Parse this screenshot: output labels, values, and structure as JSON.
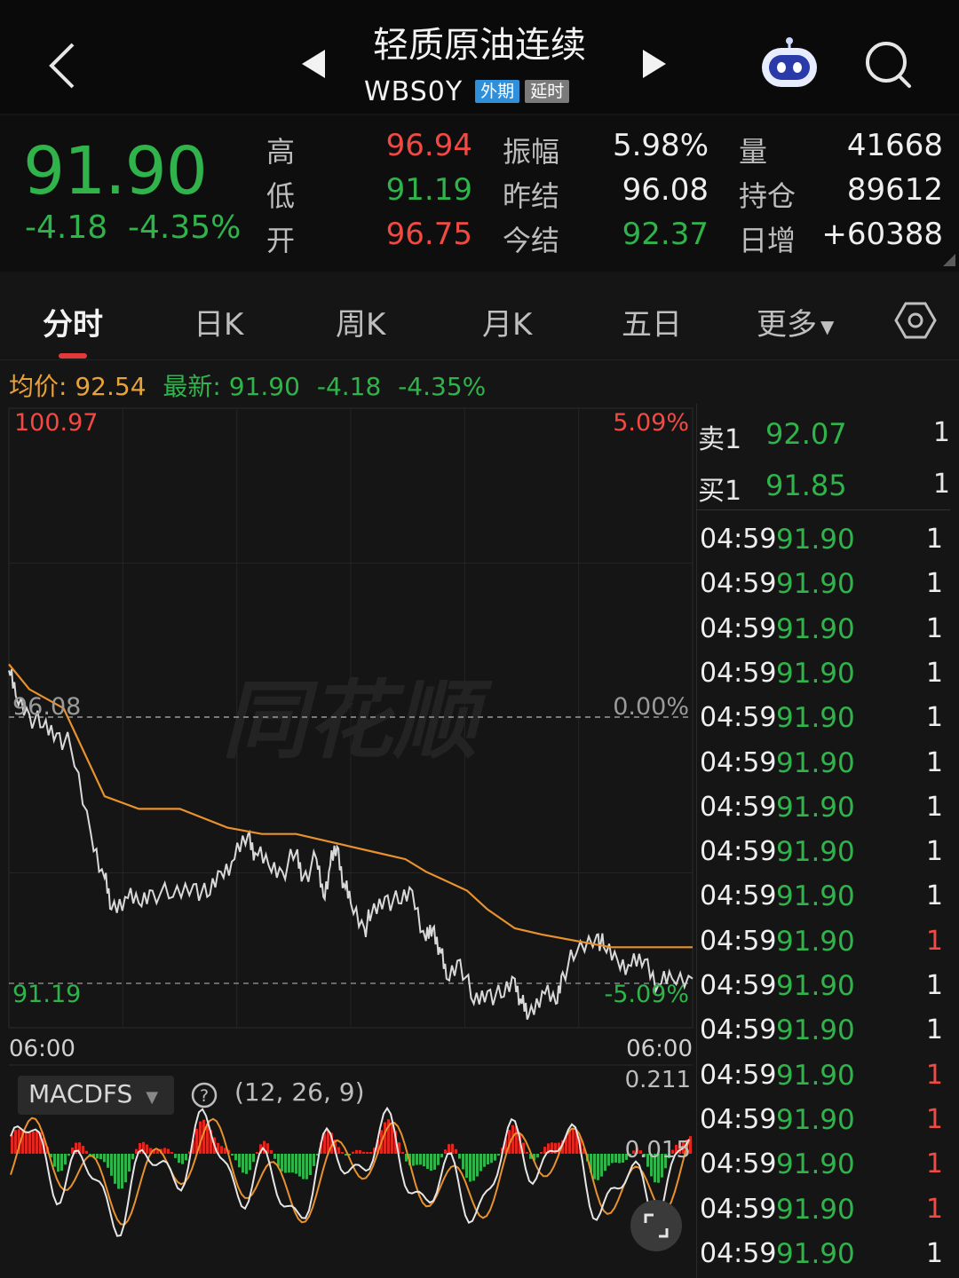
{
  "header": {
    "title": "轻质原油连续",
    "code": "WBS0Y",
    "badge_market": "外期",
    "badge_delay": "延时"
  },
  "quote": {
    "price": "91.90",
    "change": "-4.18",
    "change_pct": "-4.35%",
    "rows": [
      {
        "l1": "高",
        "v1": "96.94",
        "l2": "振幅",
        "v2": "5.98%",
        "l3": "量",
        "v3": "41668"
      },
      {
        "l1": "低",
        "v1": "91.19",
        "l2": "昨结",
        "v2": "96.08",
        "l3": "持仓",
        "v3": "89612"
      },
      {
        "l1": "开",
        "v1": "96.75",
        "l2": "今结",
        "v2": "92.37",
        "l3": "日增",
        "v3": "+60388"
      }
    ]
  },
  "tabs": [
    "分时",
    "日K",
    "周K",
    "月K",
    "五日",
    "更多"
  ],
  "info": {
    "avg_label": "均价:",
    "avg_value": "92.54",
    "latest_label": "最新:",
    "latest_value": "91.90",
    "latest_change": "-4.18",
    "latest_pct": "-4.35%"
  },
  "chart_data": {
    "type": "line",
    "y_top_label": "100.97",
    "y_mid_label": "96.08",
    "y_bottom_label": "91.19",
    "pct_top": "5.09%",
    "pct_mid": "0.00%",
    "pct_bottom": "-5.09%",
    "x_start": "06:00",
    "x_end": "06:00",
    "ylim": [
      91.19,
      100.97
    ],
    "watermark": "同花顺",
    "series": [
      {
        "color": "#d9d9d9",
        "values": [
          96.8,
          96.4,
          96.1,
          95.9,
          95.8,
          95.6,
          94.2,
          93.5,
          93.0,
          93.2,
          93.1,
          93.3,
          93.2,
          93.4,
          93.2,
          93.6,
          93.8,
          94.2,
          93.9,
          93.7,
          93.6,
          93.9,
          93.5,
          93.8,
          93.2,
          93.7,
          94.0,
          93.4,
          93.1,
          92.7,
          92.9,
          93.2,
          93.1,
          93.3,
          92.5,
          92.7,
          92.4,
          91.9,
          92.2,
          91.5,
          91.7,
          91.6,
          91.9,
          91.5,
          91.3,
          91.7,
          91.5,
          92.0,
          92.3,
          92.6,
          92.4,
          92.2,
          92.1,
          92.2,
          91.8,
          91.9,
          91.9
        ],
        "x": [
          0,
          0.01,
          0.03,
          0.05,
          0.07,
          0.09,
          0.12,
          0.14,
          0.15,
          0.17,
          0.19,
          0.21,
          0.24,
          0.27,
          0.29,
          0.31,
          0.33,
          0.35,
          0.36,
          0.38,
          0.4,
          0.42,
          0.43,
          0.45,
          0.46,
          0.47,
          0.48,
          0.49,
          0.5,
          0.52,
          0.53,
          0.55,
          0.57,
          0.59,
          0.61,
          0.62,
          0.63,
          0.64,
          0.66,
          0.68,
          0.7,
          0.72,
          0.74,
          0.75,
          0.76,
          0.78,
          0.8,
          0.81,
          0.83,
          0.86,
          0.87,
          0.89,
          0.91,
          0.93,
          0.95,
          0.97,
          1.0
        ]
      },
      {
        "color": "#e8922e",
        "values": [
          96.9,
          96.5,
          96.2,
          95.5,
          94.8,
          94.6,
          94.6,
          94.3,
          94.2,
          94.2,
          94.1,
          94.0,
          93.9,
          93.8,
          93.6,
          93.5,
          93.4,
          93.3,
          93.0,
          92.7,
          92.6,
          92.5,
          92.4,
          92.4,
          92.4
        ],
        "x": [
          0,
          0.03,
          0.08,
          0.11,
          0.14,
          0.19,
          0.25,
          0.32,
          0.37,
          0.42,
          0.46,
          0.5,
          0.54,
          0.58,
          0.61,
          0.63,
          0.65,
          0.67,
          0.7,
          0.74,
          0.78,
          0.83,
          0.88,
          0.94,
          1.0
        ]
      }
    ],
    "macd": {
      "indicator": "MACDFS",
      "params": "(12, 26, 9)",
      "top_label": "0.211",
      "mid_label": "0.015"
    }
  },
  "depth": {
    "sell_label": "卖1",
    "sell_price": "92.07",
    "sell_vol": "1",
    "buy_label": "买1",
    "buy_price": "91.85",
    "buy_vol": "1"
  },
  "trades": [
    {
      "time": "04:59",
      "price": "91.90",
      "vol": "1",
      "red": false
    },
    {
      "time": "04:59",
      "price": "91.90",
      "vol": "1",
      "red": false
    },
    {
      "time": "04:59",
      "price": "91.90",
      "vol": "1",
      "red": false
    },
    {
      "time": "04:59",
      "price": "91.90",
      "vol": "1",
      "red": false
    },
    {
      "time": "04:59",
      "price": "91.90",
      "vol": "1",
      "red": false
    },
    {
      "time": "04:59",
      "price": "91.90",
      "vol": "1",
      "red": false
    },
    {
      "time": "04:59",
      "price": "91.90",
      "vol": "1",
      "red": false
    },
    {
      "time": "04:59",
      "price": "91.90",
      "vol": "1",
      "red": false
    },
    {
      "time": "04:59",
      "price": "91.90",
      "vol": "1",
      "red": false
    },
    {
      "time": "04:59",
      "price": "91.90",
      "vol": "1",
      "red": true
    },
    {
      "time": "04:59",
      "price": "91.90",
      "vol": "1",
      "red": false
    },
    {
      "time": "04:59",
      "price": "91.90",
      "vol": "1",
      "red": false
    },
    {
      "time": "04:59",
      "price": "91.90",
      "vol": "1",
      "red": true
    },
    {
      "time": "04:59",
      "price": "91.90",
      "vol": "1",
      "red": true
    },
    {
      "time": "04:59",
      "price": "91.90",
      "vol": "1",
      "red": true
    },
    {
      "time": "04:59",
      "price": "91.90",
      "vol": "1",
      "red": true
    },
    {
      "time": "04:59",
      "price": "91.90",
      "vol": "1",
      "red": false
    }
  ]
}
